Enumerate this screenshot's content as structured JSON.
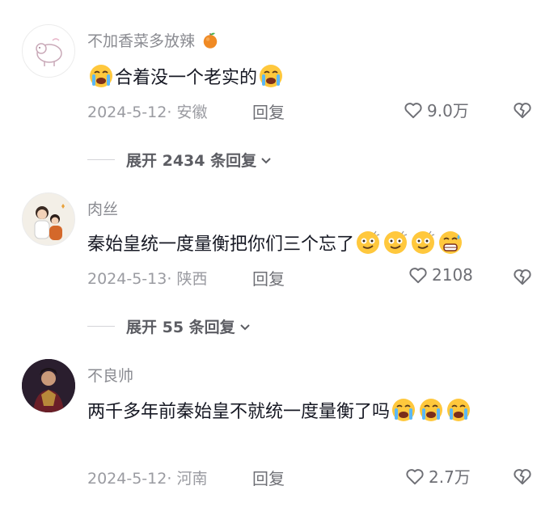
{
  "comments": [
    {
      "username": "不加香菜多放辣",
      "username_emoji": "orange-emoji",
      "text": "合着没一个老实的",
      "date": "2024-5-12",
      "location": "安徽",
      "reply_label": "回复",
      "likes": "9.0万",
      "expand_label": "展开 2434 条回复"
    },
    {
      "username": "肉丝",
      "text": "秦始皇统一度量衡把你们三个忘了",
      "date": "2024-5-13",
      "location": "陕西",
      "reply_label": "回复",
      "likes": "2108",
      "expand_label": "展开 55 条回复"
    },
    {
      "username": "不良帅",
      "text": "两千多年前秦始皇不就统一度量衡了吗",
      "date": "2024-5-12",
      "location": "河南",
      "reply_label": "回复",
      "likes": "2.7万"
    }
  ],
  "colors": {
    "username": "#8a8b91",
    "text": "#161823",
    "meta": "#9a9ba1",
    "emoji_face": "#ffc83d"
  }
}
